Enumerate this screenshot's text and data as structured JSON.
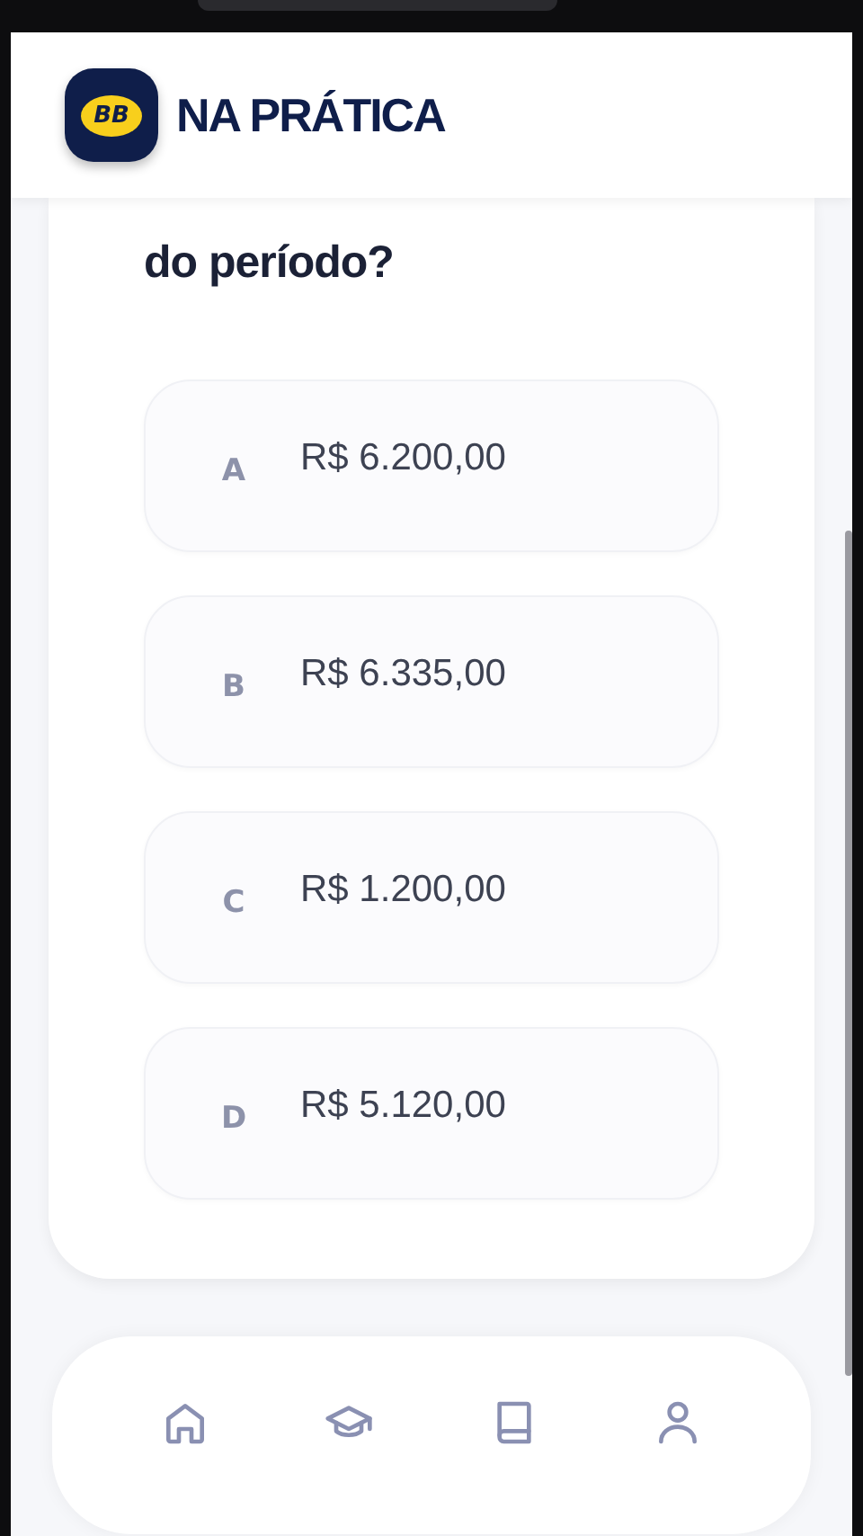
{
  "header": {
    "logo": "BB",
    "title": "NA PRÁTICA"
  },
  "question": "do período?",
  "options": [
    {
      "letter": "A",
      "value": "R$ 6.200,00"
    },
    {
      "letter": "B",
      "value": "R$ 6.335,00"
    },
    {
      "letter": "C",
      "value": "R$ 1.200,00"
    },
    {
      "letter": "D",
      "value": "R$ 5.120,00"
    }
  ],
  "nav": [
    {
      "kind": "home"
    },
    {
      "kind": "courses"
    },
    {
      "kind": "book"
    },
    {
      "kind": "profile"
    }
  ]
}
